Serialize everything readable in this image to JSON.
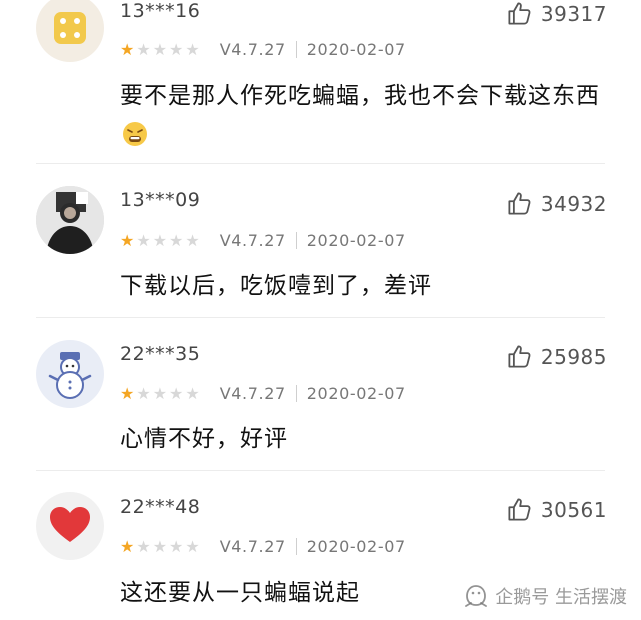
{
  "colors": {
    "star_filled": "#f4a624",
    "star_empty": "#d8d8d8",
    "divider": "#ececec"
  },
  "reviews": [
    {
      "user": "13***16",
      "avatar_icon": "yellow-dice-icon",
      "likes": "39317",
      "rating": 1,
      "version": "V4.7.27",
      "date": "2020-02-07",
      "comment": "要不是那人作死吃蝙蝠，我也不会下载这东西",
      "emoji": "tired-face-emoji"
    },
    {
      "user": "13***09",
      "avatar_icon": "person-photo-icon",
      "likes": "34932",
      "rating": 1,
      "version": "V4.7.27",
      "date": "2020-02-07",
      "comment": "下载以后，吃饭噎到了，差评"
    },
    {
      "user": "22***35",
      "avatar_icon": "snowman-icon",
      "likes": "25985",
      "rating": 1,
      "version": "V4.7.27",
      "date": "2020-02-07",
      "comment": "心情不好，好评"
    },
    {
      "user": "22***48",
      "avatar_icon": "heart-icon",
      "likes": "30561",
      "rating": 1,
      "version": "V4.7.27",
      "date": "2020-02-07",
      "comment": "这还要从一只蝙蝠说起"
    }
  ],
  "watermark": {
    "text": "企鹅号 生活摆渡",
    "icon": "penguin-logo-icon"
  }
}
